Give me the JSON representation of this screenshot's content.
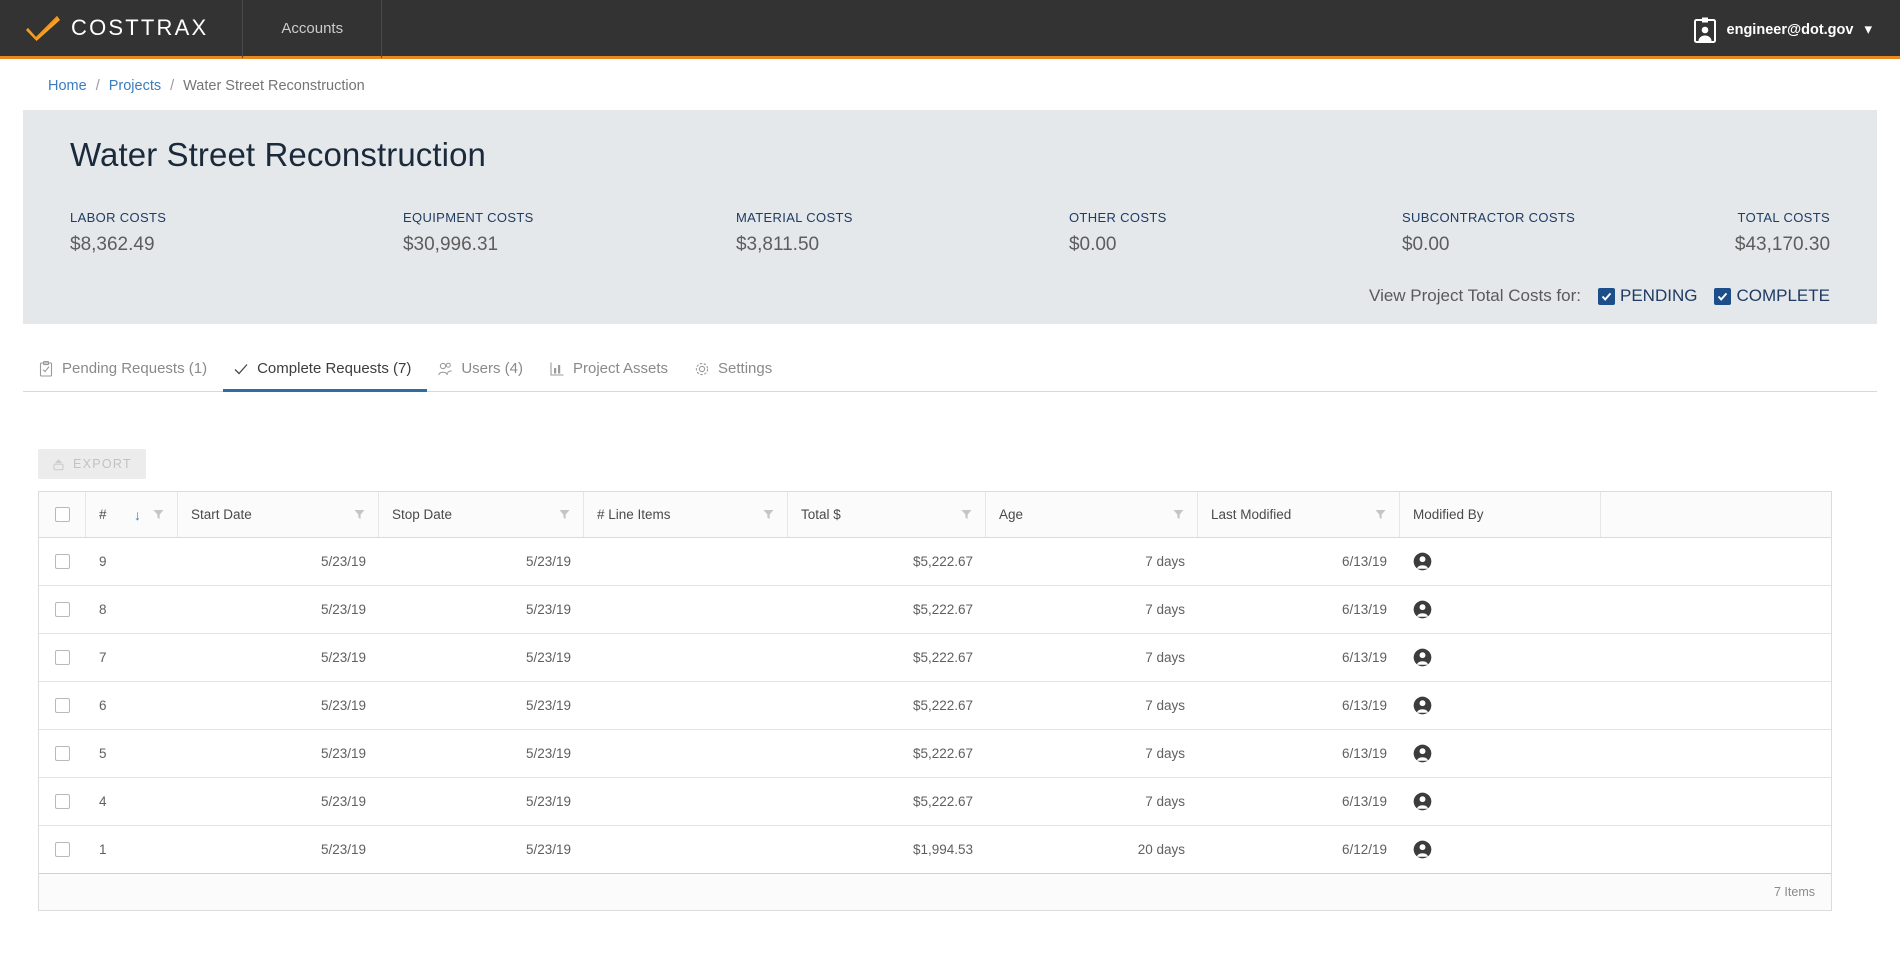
{
  "topnav": {
    "brand": "COSTTRAX",
    "brand_logo_icon": "orange-check-logo",
    "accounts_label": "Accounts",
    "user_email": "engineer@dot.gov",
    "user_icon": "id-badge-icon",
    "chevron": "⌄",
    "bg_color": "#333333",
    "accent_color": "#e8871e"
  },
  "breadcrumb": {
    "home": "Home",
    "projects": "Projects",
    "current": "Water Street Reconstruction",
    "separator": "/"
  },
  "project": {
    "title": "Water Street Reconstruction",
    "costs": [
      {
        "label": "LABOR COSTS",
        "value": "$8,362.49"
      },
      {
        "label": "EQUIPMENT COSTS",
        "value": "$30,996.31"
      },
      {
        "label": "MATERIAL COSTS",
        "value": "$3,811.50"
      },
      {
        "label": "OTHER COSTS",
        "value": "$0.00"
      },
      {
        "label": "SUBCONTRACTOR COSTS",
        "value": "$0.00"
      },
      {
        "label": "TOTAL COSTS",
        "value": "$43,170.30"
      }
    ],
    "view_costs_label": "View Project Total Costs for:",
    "pending_label": "PENDING",
    "pending_checked": true,
    "complete_label": "COMPLETE",
    "complete_checked": true
  },
  "tabs": [
    {
      "label": "Pending Requests (1)",
      "icon": "clipboard-check-icon",
      "active": false
    },
    {
      "label": "Complete Requests (7)",
      "icon": "check-icon",
      "active": true
    },
    {
      "label": "Users (4)",
      "icon": "users-icon",
      "active": false
    },
    {
      "label": "Project Assets",
      "icon": "chart-icon",
      "active": false
    },
    {
      "label": "Settings",
      "icon": "gear-icon",
      "active": false
    }
  ],
  "toolbar": {
    "export_label": "EXPORT",
    "export_icon": "export-icon",
    "export_disabled": true
  },
  "table": {
    "columns": [
      {
        "label": "#",
        "filter": true,
        "sorted": "desc",
        "sort_icon": "arrow-down-icon"
      },
      {
        "label": "Start Date",
        "filter": true
      },
      {
        "label": "Stop Date",
        "filter": true
      },
      {
        "label": "# Line Items",
        "filter": true
      },
      {
        "label": "Total $",
        "filter": true
      },
      {
        "label": "Age",
        "filter": true
      },
      {
        "label": "Last Modified",
        "filter": true
      },
      {
        "label": "Modified By",
        "filter": false
      }
    ],
    "rows": [
      {
        "num": "9",
        "start": "5/23/19",
        "stop": "5/23/19",
        "line_items": "",
        "total": "$5,222.67",
        "age": "7 days",
        "modified": "6/13/19",
        "modified_by_icon": "user-avatar-icon",
        "selected": false
      },
      {
        "num": "8",
        "start": "5/23/19",
        "stop": "5/23/19",
        "line_items": "",
        "total": "$5,222.67",
        "age": "7 days",
        "modified": "6/13/19",
        "modified_by_icon": "user-avatar-icon",
        "selected": false
      },
      {
        "num": "7",
        "start": "5/23/19",
        "stop": "5/23/19",
        "line_items": "",
        "total": "$5,222.67",
        "age": "7 days",
        "modified": "6/13/19",
        "modified_by_icon": "user-avatar-icon",
        "selected": false
      },
      {
        "num": "6",
        "start": "5/23/19",
        "stop": "5/23/19",
        "line_items": "",
        "total": "$5,222.67",
        "age": "7 days",
        "modified": "6/13/19",
        "modified_by_icon": "user-avatar-icon",
        "selected": false
      },
      {
        "num": "5",
        "start": "5/23/19",
        "stop": "5/23/19",
        "line_items": "",
        "total": "$5,222.67",
        "age": "7 days",
        "modified": "6/13/19",
        "modified_by_icon": "user-avatar-icon",
        "selected": false
      },
      {
        "num": "4",
        "start": "5/23/19",
        "stop": "5/23/19",
        "line_items": "",
        "total": "$5,222.67",
        "age": "7 days",
        "modified": "6/13/19",
        "modified_by_icon": "user-avatar-icon",
        "selected": false
      },
      {
        "num": "1",
        "start": "5/23/19",
        "stop": "5/23/19",
        "line_items": "",
        "total": "$1,994.53",
        "age": "20 days",
        "modified": "6/12/19",
        "modified_by_icon": "user-avatar-icon",
        "selected": false
      }
    ],
    "footer_count": "7 Items"
  }
}
